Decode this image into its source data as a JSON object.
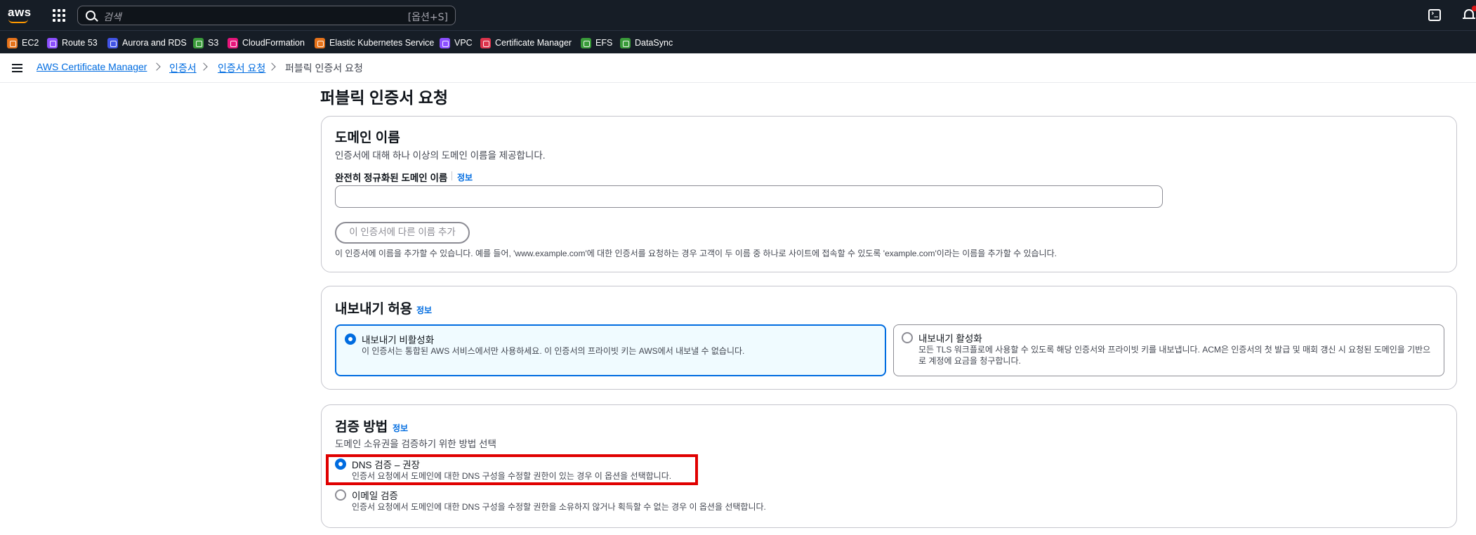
{
  "topnav": {
    "logo_text": "aws",
    "search_placeholder": "검색",
    "search_shortcut": "[옵션+S]",
    "icons": [
      "services-grid-icon",
      "search-icon",
      "cloudshell-icon",
      "bell-icon"
    ]
  },
  "favorites": [
    {
      "label": "EC2",
      "color": "#e7731a"
    },
    {
      "label": "Route 53",
      "color": "#8c4fff"
    },
    {
      "label": "Aurora and RDS",
      "color": "#4153e5"
    },
    {
      "label": "S3",
      "color": "#3a9b3a"
    },
    {
      "label": "CloudFormation",
      "color": "#e7157b"
    },
    {
      "label": "Elastic Kubernetes Service",
      "color": "#e7731a"
    },
    {
      "label": "VPC",
      "color": "#8c4fff"
    },
    {
      "label": "Certificate Manager",
      "color": "#dd344c"
    },
    {
      "label": "EFS",
      "color": "#3a9b3a"
    },
    {
      "label": "DataSync",
      "color": "#3a9b3a"
    }
  ],
  "breadcrumb": [
    "AWS Certificate Manager",
    "인증서",
    "인증서 요청",
    "퍼블릭 인증서 요청"
  ],
  "page_title": "퍼블릭 인증서 요청",
  "domain_section": {
    "title": "도메인 이름",
    "description": "인증서에 대해 하나 이상의 도메인 이름을 제공합니다.",
    "field_label": "완전히 정규화된 도메인 이름",
    "info": "정보",
    "field_value": "",
    "add_button": "이 인증서에 다른 이름 추가",
    "hint": "이 인증서에 이름을 추가할 수 있습니다. 예를 들어, 'www.example.com'에 대한 인증서를 요청하는 경우 고객이 두 이름 중 하나로 사이트에 접속할 수 있도록 'example.com'이라는 이름을 추가할 수 있습니다."
  },
  "export_section": {
    "title": "내보내기 허용",
    "info": "정보",
    "options": [
      {
        "title": "내보내기 비활성화",
        "description": "이 인증서는 통합된 AWS 서비스에서만 사용하세요. 이 인증서의 프라이빗 키는 AWS에서 내보낼 수 없습니다.",
        "selected": true
      },
      {
        "title": "내보내기 활성화",
        "description": "모든 TLS 워크플로에 사용할 수 있도록 해당 인증서와 프라이빗 키를 내보냅니다. ACM은 인증서의 첫 발급 및 매회 갱신 시 요청된 도메인을 기반으로 계정에 요금을 청구합니다.",
        "selected": false
      }
    ]
  },
  "validation_section": {
    "title": "검증 방법",
    "info": "정보",
    "description": "도메인 소유권을 검증하기 위한 방법 선택",
    "options": [
      {
        "title": "DNS 검증 – 권장",
        "description": "인증서 요청에서 도메인에 대한 DNS 구성을 수정할 권한이 있는 경우 이 옵션을 선택합니다.",
        "selected": true
      },
      {
        "title": "이메일 검증",
        "description": "인증서 요청에서 도메인에 대한 DNS 구성을 수정할 권한을 소유하지 않거나 획득할 수 없는 경우 이 옵션을 선택합니다.",
        "selected": false
      }
    ]
  },
  "colors": {
    "nav_bg": "#161d26",
    "link": "#006ce0",
    "highlight": "#e00000"
  }
}
